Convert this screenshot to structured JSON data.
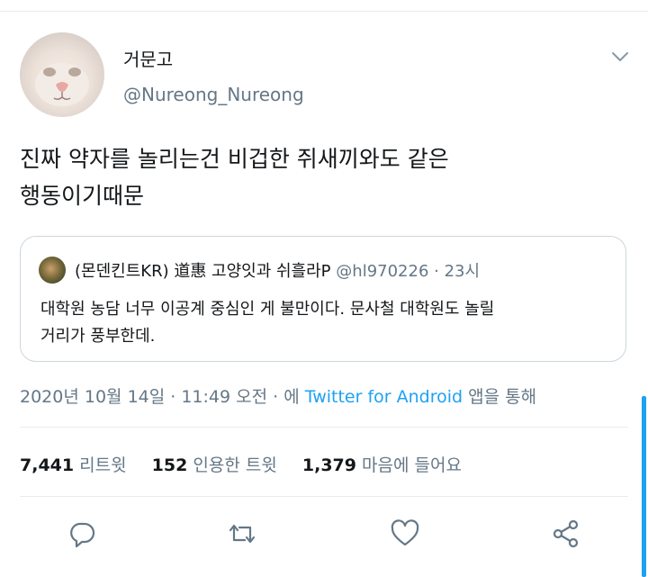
{
  "tweet": {
    "display_name": "거문고",
    "handle": "@Nureong_Nureong",
    "text_line1": "진짜 약자를 놀리는건 비겁한 쥐새끼와도 같은",
    "text_line2": "행동이기때문"
  },
  "quote": {
    "name": "(몬덴킨트KR) 道惠 고양잇과 쉬흘라P",
    "handle": "@hl970226",
    "time": "· 23시",
    "text_line1": "대학원 농담 너무 이공계 중심인 게 불만이다. 문사철 대학원도 놀릴",
    "text_line2": "거리가 풍부한데."
  },
  "timestamp": {
    "datetime": "2020년 10월 14일 · 11:49 오전 · 에",
    "client": "Twitter for Android",
    "suffix": "앱을 통해"
  },
  "stats": {
    "retweets_count": "7,441",
    "retweets_label": "리트윗",
    "quotes_count": "152",
    "quotes_label": "인용한 트윗",
    "likes_count": "1,379",
    "likes_label": "마음에 들어요"
  },
  "actions": {
    "reply_icon": "reply-icon",
    "retweet_icon": "retweet-icon",
    "like_icon": "heart-icon",
    "share_icon": "share-icon"
  },
  "colors": {
    "accent": "#1da1f2",
    "secondary_text": "#657786",
    "primary_text": "#14171a",
    "divider": "#e6ecf0"
  }
}
